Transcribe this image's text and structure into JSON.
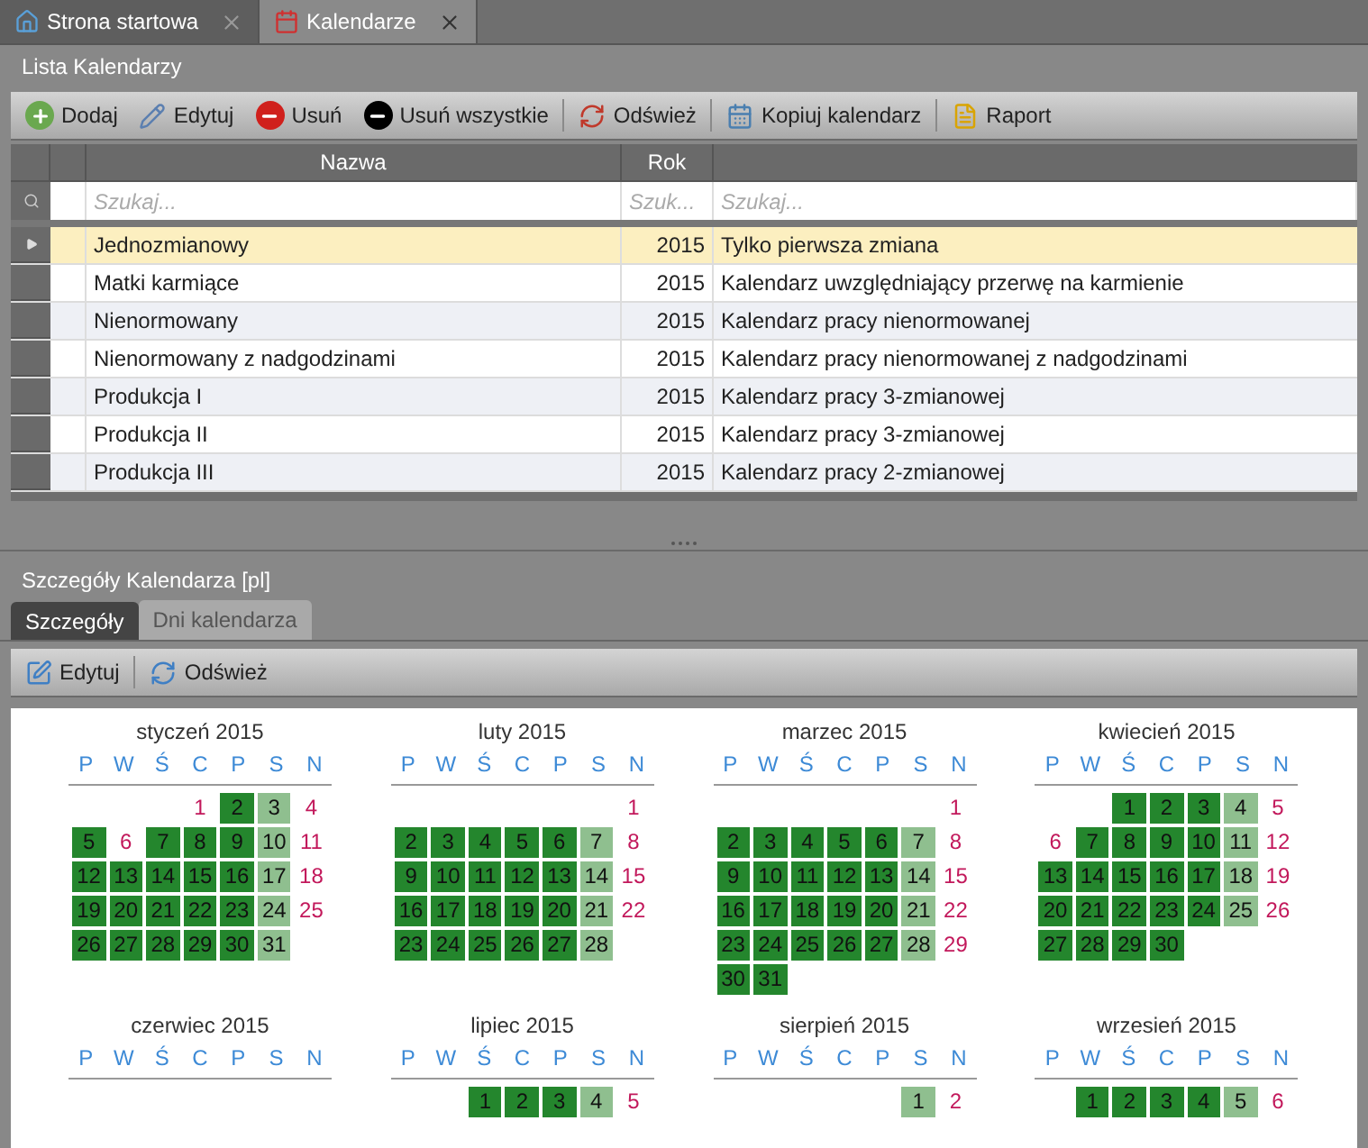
{
  "doc_tabs": [
    {
      "label": "Strona startowa",
      "selected": false
    },
    {
      "label": "Kalendarze",
      "selected": true
    }
  ],
  "list_panel": {
    "title": "Lista Kalendarzy",
    "toolbar": [
      {
        "label": "Dodaj"
      },
      {
        "label": "Edytuj"
      },
      {
        "label": "Usuń"
      },
      {
        "label": "Usuń wszystkie",
        "separator_after": true
      },
      {
        "label": "Odśwież",
        "separator_after": true
      },
      {
        "label": "Kopiuj kalendarz",
        "separator_after": true
      },
      {
        "label": "Raport"
      }
    ],
    "columns": [
      "Nazwa",
      "Rok"
    ],
    "filters": [
      {
        "placeholder": "Szukaj..."
      },
      {
        "placeholder": "Szuk..."
      },
      {
        "placeholder": "Szukaj..."
      }
    ],
    "rows": [
      {
        "name": "Jednozmianowy",
        "year": "2015",
        "description": "Tylko pierwsza zmiana",
        "selected": true
      },
      {
        "name": "Matki karmiące",
        "year": "2015",
        "description": "Kalendarz uwzględniający przerwę na karmienie",
        "selected": false
      },
      {
        "name": "Nienormowany",
        "year": "2015",
        "description": "Kalendarz pracy nienormowanej",
        "selected": false
      },
      {
        "name": "Nienormowany z nadgodzinami",
        "year": "2015",
        "description": "Kalendarz pracy nienormowanej z nadgodzinami",
        "selected": false
      },
      {
        "name": "Produkcja I",
        "year": "2015",
        "description": "Kalendarz pracy 3-zmianowej",
        "selected": false
      },
      {
        "name": "Produkcja II",
        "year": "2015",
        "description": "Kalendarz pracy 3-zmianowej",
        "selected": false
      },
      {
        "name": "Produkcja III",
        "year": "2015",
        "description": "Kalendarz pracy 2-zmianowej",
        "selected": false
      }
    ]
  },
  "details_panel": {
    "title": "Szczegóły Kalendarza [pl]",
    "tabs": [
      {
        "label": "Szczegóły",
        "selected": false
      },
      {
        "label": "Dni kalendarza",
        "selected": true
      }
    ],
    "toolbar": [
      {
        "label": "Edytuj",
        "separator_after": true
      },
      {
        "label": "Odśwież"
      }
    ],
    "months": [
      {
        "title": "styczeń 2015",
        "weekdays": [
          "P",
          "W",
          "Ś",
          "C",
          "P",
          "S",
          "N"
        ],
        "weeks": [
          [
            {
              "kind": "blank"
            },
            {
              "kind": "blank"
            },
            {
              "kind": "blank"
            },
            {
              "day": "1",
              "kind": "off"
            },
            {
              "day": "2",
              "kind": "work"
            },
            {
              "day": "3",
              "kind": "sat"
            },
            {
              "day": "4",
              "kind": "off"
            }
          ],
          [
            {
              "day": "5",
              "kind": "work"
            },
            {
              "day": "6",
              "kind": "off"
            },
            {
              "day": "7",
              "kind": "work"
            },
            {
              "day": "8",
              "kind": "work"
            },
            {
              "day": "9",
              "kind": "work"
            },
            {
              "day": "10",
              "kind": "sat"
            },
            {
              "day": "11",
              "kind": "off"
            }
          ],
          [
            {
              "day": "12",
              "kind": "work"
            },
            {
              "day": "13",
              "kind": "work"
            },
            {
              "day": "14",
              "kind": "work"
            },
            {
              "day": "15",
              "kind": "work"
            },
            {
              "day": "16",
              "kind": "work"
            },
            {
              "day": "17",
              "kind": "sat"
            },
            {
              "day": "18",
              "kind": "off"
            }
          ],
          [
            {
              "day": "19",
              "kind": "work"
            },
            {
              "day": "20",
              "kind": "work"
            },
            {
              "day": "21",
              "kind": "work"
            },
            {
              "day": "22",
              "kind": "work"
            },
            {
              "day": "23",
              "kind": "work"
            },
            {
              "day": "24",
              "kind": "sat"
            },
            {
              "day": "25",
              "kind": "off"
            }
          ],
          [
            {
              "day": "26",
              "kind": "work"
            },
            {
              "day": "27",
              "kind": "work"
            },
            {
              "day": "28",
              "kind": "work"
            },
            {
              "day": "29",
              "kind": "work"
            },
            {
              "day": "30",
              "kind": "work"
            },
            {
              "day": "31",
              "kind": "sat"
            }
          ]
        ]
      },
      {
        "title": "luty 2015",
        "weekdays": [
          "P",
          "W",
          "Ś",
          "C",
          "P",
          "S",
          "N"
        ],
        "weeks": [
          [
            {
              "kind": "blank"
            },
            {
              "kind": "blank"
            },
            {
              "kind": "blank"
            },
            {
              "kind": "blank"
            },
            {
              "kind": "blank"
            },
            {
              "kind": "blank"
            },
            {
              "day": "1",
              "kind": "off"
            }
          ],
          [
            {
              "day": "2",
              "kind": "work"
            },
            {
              "day": "3",
              "kind": "work"
            },
            {
              "day": "4",
              "kind": "work"
            },
            {
              "day": "5",
              "kind": "work"
            },
            {
              "day": "6",
              "kind": "work"
            },
            {
              "day": "7",
              "kind": "sat"
            },
            {
              "day": "8",
              "kind": "off"
            }
          ],
          [
            {
              "day": "9",
              "kind": "work"
            },
            {
              "day": "10",
              "kind": "work"
            },
            {
              "day": "11",
              "kind": "work"
            },
            {
              "day": "12",
              "kind": "work"
            },
            {
              "day": "13",
              "kind": "work"
            },
            {
              "day": "14",
              "kind": "sat"
            },
            {
              "day": "15",
              "kind": "off"
            }
          ],
          [
            {
              "day": "16",
              "kind": "work"
            },
            {
              "day": "17",
              "kind": "work"
            },
            {
              "day": "18",
              "kind": "work"
            },
            {
              "day": "19",
              "kind": "work"
            },
            {
              "day": "20",
              "kind": "work"
            },
            {
              "day": "21",
              "kind": "sat"
            },
            {
              "day": "22",
              "kind": "off"
            }
          ],
          [
            {
              "day": "23",
              "kind": "work"
            },
            {
              "day": "24",
              "kind": "work"
            },
            {
              "day": "25",
              "kind": "work"
            },
            {
              "day": "26",
              "kind": "work"
            },
            {
              "day": "27",
              "kind": "work"
            },
            {
              "day": "28",
              "kind": "sat"
            }
          ]
        ]
      },
      {
        "title": "marzec 2015",
        "weekdays": [
          "P",
          "W",
          "Ś",
          "C",
          "P",
          "S",
          "N"
        ],
        "weeks": [
          [
            {
              "kind": "blank"
            },
            {
              "kind": "blank"
            },
            {
              "kind": "blank"
            },
            {
              "kind": "blank"
            },
            {
              "kind": "blank"
            },
            {
              "kind": "blank"
            },
            {
              "day": "1",
              "kind": "off"
            }
          ],
          [
            {
              "day": "2",
              "kind": "work"
            },
            {
              "day": "3",
              "kind": "work"
            },
            {
              "day": "4",
              "kind": "work"
            },
            {
              "day": "5",
              "kind": "work"
            },
            {
              "day": "6",
              "kind": "work"
            },
            {
              "day": "7",
              "kind": "sat"
            },
            {
              "day": "8",
              "kind": "off"
            }
          ],
          [
            {
              "day": "9",
              "kind": "work"
            },
            {
              "day": "10",
              "kind": "work"
            },
            {
              "day": "11",
              "kind": "work"
            },
            {
              "day": "12",
              "kind": "work"
            },
            {
              "day": "13",
              "kind": "work"
            },
            {
              "day": "14",
              "kind": "sat"
            },
            {
              "day": "15",
              "kind": "off"
            }
          ],
          [
            {
              "day": "16",
              "kind": "work"
            },
            {
              "day": "17",
              "kind": "work"
            },
            {
              "day": "18",
              "kind": "work"
            },
            {
              "day": "19",
              "kind": "work"
            },
            {
              "day": "20",
              "kind": "work"
            },
            {
              "day": "21",
              "kind": "sat"
            },
            {
              "day": "22",
              "kind": "off"
            }
          ],
          [
            {
              "day": "23",
              "kind": "work"
            },
            {
              "day": "24",
              "kind": "work"
            },
            {
              "day": "25",
              "kind": "work"
            },
            {
              "day": "26",
              "kind": "work"
            },
            {
              "day": "27",
              "kind": "work"
            },
            {
              "day": "28",
              "kind": "sat"
            },
            {
              "day": "29",
              "kind": "off"
            }
          ],
          [
            {
              "day": "30",
              "kind": "work"
            },
            {
              "day": "31",
              "kind": "work"
            }
          ]
        ]
      },
      {
        "title": "kwiecień 2015",
        "weekdays": [
          "P",
          "W",
          "Ś",
          "C",
          "P",
          "S",
          "N"
        ],
        "weeks": [
          [
            {
              "kind": "blank"
            },
            {
              "kind": "blank"
            },
            {
              "day": "1",
              "kind": "work"
            },
            {
              "day": "2",
              "kind": "work"
            },
            {
              "day": "3",
              "kind": "work"
            },
            {
              "day": "4",
              "kind": "sat"
            },
            {
              "day": "5",
              "kind": "off"
            }
          ],
          [
            {
              "day": "6",
              "kind": "off"
            },
            {
              "day": "7",
              "kind": "work"
            },
            {
              "day": "8",
              "kind": "work"
            },
            {
              "day": "9",
              "kind": "work"
            },
            {
              "day": "10",
              "kind": "work"
            },
            {
              "day": "11",
              "kind": "sat"
            },
            {
              "day": "12",
              "kind": "off"
            }
          ],
          [
            {
              "day": "13",
              "kind": "work"
            },
            {
              "day": "14",
              "kind": "work"
            },
            {
              "day": "15",
              "kind": "work"
            },
            {
              "day": "16",
              "kind": "work"
            },
            {
              "day": "17",
              "kind": "work"
            },
            {
              "day": "18",
              "kind": "sat"
            },
            {
              "day": "19",
              "kind": "off"
            }
          ],
          [
            {
              "day": "20",
              "kind": "work"
            },
            {
              "day": "21",
              "kind": "work"
            },
            {
              "day": "22",
              "kind": "work"
            },
            {
              "day": "23",
              "kind": "work"
            },
            {
              "day": "24",
              "kind": "work"
            },
            {
              "day": "25",
              "kind": "sat"
            },
            {
              "day": "26",
              "kind": "off"
            }
          ],
          [
            {
              "day": "27",
              "kind": "work"
            },
            {
              "day": "28",
              "kind": "work"
            },
            {
              "day": "29",
              "kind": "work"
            },
            {
              "day": "30",
              "kind": "work"
            }
          ]
        ]
      },
      {
        "title": "czerwiec 2015",
        "weekdays": [
          "P",
          "W",
          "Ś",
          "C",
          "P",
          "S",
          "N"
        ]
      },
      {
        "title": "lipiec 2015",
        "weekdays": [
          "P",
          "W",
          "Ś",
          "C",
          "P",
          "S",
          "N"
        ],
        "weeks": [
          [
            {
              "kind": "blank"
            },
            {
              "kind": "blank"
            },
            {
              "day": "1",
              "kind": "work"
            },
            {
              "day": "2",
              "kind": "work"
            },
            {
              "day": "3",
              "kind": "work"
            },
            {
              "day": "4",
              "kind": "sat"
            },
            {
              "day": "5",
              "kind": "off"
            }
          ]
        ]
      },
      {
        "title": "sierpień 2015",
        "weekdays": [
          "P",
          "W",
          "Ś",
          "C",
          "P",
          "S",
          "N"
        ],
        "weeks": [
          [
            {
              "kind": "blank"
            },
            {
              "kind": "blank"
            },
            {
              "kind": "blank"
            },
            {
              "kind": "blank"
            },
            {
              "kind": "blank"
            },
            {
              "day": "1",
              "kind": "sat"
            },
            {
              "day": "2",
              "kind": "off"
            }
          ]
        ]
      },
      {
        "title": "wrzesień 2015",
        "weekdays": [
          "P",
          "W",
          "Ś",
          "C",
          "P",
          "S",
          "N"
        ],
        "weeks": [
          [
            {
              "kind": "blank"
            },
            {
              "day": "1",
              "kind": "work"
            },
            {
              "day": "2",
              "kind": "work"
            },
            {
              "day": "3",
              "kind": "work"
            },
            {
              "day": "4",
              "kind": "work"
            },
            {
              "day": "5",
              "kind": "sat"
            },
            {
              "day": "6",
              "kind": "off"
            }
          ]
        ]
      }
    ]
  }
}
